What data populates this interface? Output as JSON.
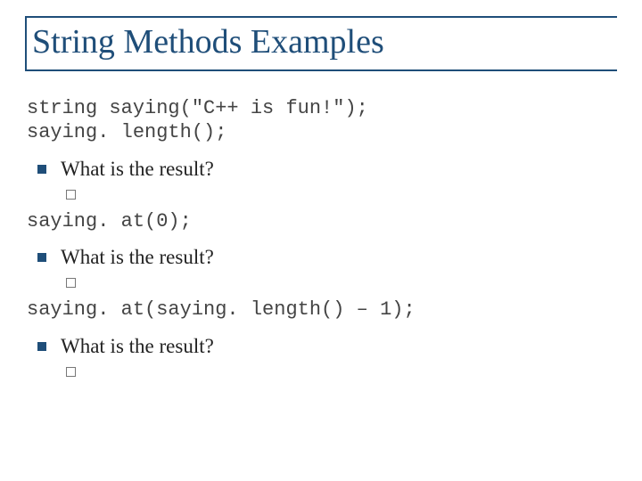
{
  "title": "String Methods Examples",
  "code1_line1": "string saying(\"C++ is fun!\");",
  "code1_line2": "saying. length();",
  "q1": "What is the result?",
  "code2": "saying. at(0);",
  "q2": "What is the result?",
  "code3": "saying. at(saying. length() – 1);",
  "q3": "What is the result?"
}
